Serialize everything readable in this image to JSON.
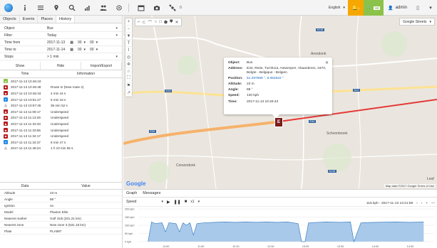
{
  "toolbar": {
    "icons": [
      "globe-icon",
      "info-icon",
      "list-icon",
      "pin-icon",
      "search-icon",
      "chart-icon",
      "users-icon",
      "gear-icon",
      "calendar-icon",
      "camera-icon",
      "satellite-icon"
    ],
    "object_count": "0",
    "language": "English",
    "alerts_count": "1",
    "cart_count": "88",
    "username": "admin"
  },
  "left": {
    "tabs": [
      "Objects",
      "Events",
      "Places",
      "History"
    ],
    "active_tab": "History",
    "form": {
      "object_label": "Object",
      "object_value": "Bus",
      "filter_label": "Filter",
      "filter_value": "Today",
      "time_from_label": "Time from",
      "time_from_date": "2017-11-13",
      "time_from_h": "00",
      "time_from_m": "00",
      "time_to_label": "Time to",
      "time_to_date": "2017-11-14",
      "time_to_h": "00",
      "time_to_m": "00",
      "stops_label": "Stops",
      "stops_value": "> 1 min"
    },
    "buttons": {
      "show": "Show",
      "hide": "Hide",
      "import_export": "Import/Export"
    },
    "history_headers": {
      "time": "Time",
      "information": "Information"
    },
    "history_rows": [
      {
        "type": "start",
        "time": "2017-11-13 10:46:43",
        "info": ""
      },
      {
        "type": "route",
        "time": "2017-11-13 10:46:48",
        "info": "Route In (New route 2)"
      },
      {
        "type": "route",
        "time": "2017-11-13 10:46:43",
        "info": "4 min 44 s"
      },
      {
        "type": "stop",
        "time": "2017-11-13 10:51:27",
        "info": "6 min 18 s"
      },
      {
        "type": "under",
        "time": "2017-11-13 10:57:45",
        "info": "36 min 52 s"
      },
      {
        "type": "speed",
        "time": "2017-11-13 11:08:17",
        "info": "Underspeed"
      },
      {
        "type": "speed",
        "time": "2017-11-13 11:13:26",
        "info": "Underspeed"
      },
      {
        "type": "speed",
        "time": "2017-11-13 11:33:33",
        "info": "Underspeed"
      },
      {
        "type": "speed",
        "time": "2017-11-13 11:33:56",
        "info": "Underspeed"
      },
      {
        "type": "speed",
        "time": "2017-11-13 11:34:17",
        "info": "Underspeed"
      },
      {
        "type": "stop",
        "time": "2017-11-13 11:34:37",
        "info": "8 min 47 s"
      },
      {
        "type": "under",
        "time": "2017-11-13 11:48:24",
        "info": "1 h 10 min 55 s"
      }
    ],
    "info_headers": {
      "data": "Data",
      "value": "Value"
    },
    "info_rows": [
      {
        "k": "Altitude",
        "v": "23 m"
      },
      {
        "k": "Angle",
        "v": "88 °"
      },
      {
        "k": "Ignition",
        "v": "on"
      },
      {
        "k": "Model",
        "v": "Plaxton Elite"
      },
      {
        "k": "Nearest marker",
        "v": "Golf club (201.21 km)"
      },
      {
        "k": "Nearest zone",
        "v": "New zone 3 (531.18 km)"
      },
      {
        "k": "Plate",
        "v": "PLA987"
      }
    ]
  },
  "map": {
    "map_type": "Google Streets",
    "labels": [
      "Arendonk",
      "Schoonbroek",
      "Corsendonk",
      "Leaf"
    ],
    "road_shields": [
      "N118",
      "N18",
      "E34",
      "N18",
      "N12",
      "E34",
      "N118"
    ],
    "marker_letter": "E",
    "attribution": "Map data ©2017 Google  Terms of Use",
    "google": "Google",
    "popup": {
      "object_label": "Object:",
      "object_value": "Bus",
      "address_label": "Address:",
      "address_value": "E34, Retie, Turnhout, Antwerpen, Vlaanderen, 2470, Belgïe - Belgique - Belgien",
      "position_label": "Position:",
      "position_value": "51.297558 °, 5.062522 °",
      "altitude_label": "Altitude:",
      "altitude_value": "23 m",
      "angle_label": "Angle:",
      "angle_value": "88 °",
      "speed_label": "Speed:",
      "speed_value": "130 kph",
      "time_label": "Time:",
      "time_value": "2017-11-13 10:46:43"
    }
  },
  "graph": {
    "tabs": [
      "Graph",
      "Messages"
    ],
    "selector": "Speed",
    "multiplier": "x1",
    "readout": "115 kph - 2017-11-13 13:21:59",
    "colors": {
      "fill": "#a9c9ea",
      "stroke": "#3d7fc4"
    }
  },
  "chart_data": {
    "type": "area",
    "title": "",
    "ylabel": "",
    "yticks": [
      "200 kph",
      "150 kph",
      "100 kph",
      "50 kph",
      "0 kph"
    ],
    "ylim": [
      0,
      200
    ],
    "xticks": [
      "11:00",
      "11:30",
      "12:00",
      "12:30",
      "13:00",
      "13:30",
      "14:00",
      "14:30"
    ],
    "x": [
      10.75,
      10.8,
      10.85,
      10.95,
      11.0,
      11.05,
      11.15,
      11.2,
      11.25,
      11.3,
      11.35,
      11.4,
      11.45,
      11.55,
      11.7,
      11.85,
      12.0,
      12.15,
      12.3,
      12.45,
      12.6,
      12.75,
      12.9,
      12.95,
      13.0,
      13.05,
      13.3,
      13.5,
      13.65,
      13.7,
      13.8,
      14.0,
      14.3,
      14.5,
      14.7
    ],
    "values": [
      0,
      120,
      110,
      115,
      60,
      115,
      110,
      60,
      115,
      100,
      115,
      40,
      110,
      115,
      118,
      120,
      118,
      120,
      118,
      120,
      118,
      120,
      110,
      0,
      0,
      115,
      120,
      118,
      120,
      0,
      115,
      118,
      120,
      118,
      120
    ]
  }
}
